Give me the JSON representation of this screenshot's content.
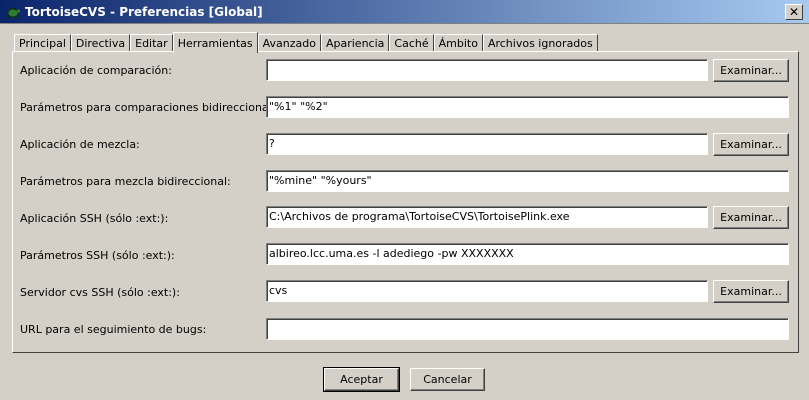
{
  "window": {
    "title": "TortoiseCVS - Preferencias [Global]",
    "close_glyph": "✕",
    "icon": "tortoise-icon"
  },
  "tabs": [
    {
      "label": "Principal",
      "active": false
    },
    {
      "label": "Directiva",
      "active": false
    },
    {
      "label": "Editar",
      "active": false
    },
    {
      "label": "Herramientas",
      "active": true
    },
    {
      "label": "Avanzado",
      "active": false
    },
    {
      "label": "Apariencia",
      "active": false
    },
    {
      "label": "Caché",
      "active": false
    },
    {
      "label": "Ámbito",
      "active": false
    },
    {
      "label": "Archivos ignorados",
      "active": false
    }
  ],
  "rows": [
    {
      "label": "Aplicación de comparación:",
      "value": "",
      "browse": "Examinar..."
    },
    {
      "label": "Parámetros para comparaciones bidireccionales:",
      "value": "\"%1\" \"%2\""
    },
    {
      "label": "Aplicación de mezcla:",
      "value": "?",
      "browse": "Examinar..."
    },
    {
      "label": "Parámetros para mezcla bidireccional:",
      "value": "\"%mine\" \"%yours\""
    },
    {
      "label": "Aplicación SSH (sólo :ext:):",
      "value": "C:\\Archivos de programa\\TortoiseCVS\\TortoisePlink.exe",
      "browse": "Examinar..."
    },
    {
      "label": "Parámetros SSH (sólo :ext:):",
      "value": "albireo.lcc.uma.es -l adediego -pw XXXXXXX"
    },
    {
      "label": "Servidor cvs SSH (sólo :ext:):",
      "value": "cvs",
      "browse": "Examinar..."
    },
    {
      "label": "URL para el seguimiento de bugs:",
      "value": ""
    }
  ],
  "buttons": {
    "accept": "Aceptar",
    "cancel": "Cancelar"
  }
}
